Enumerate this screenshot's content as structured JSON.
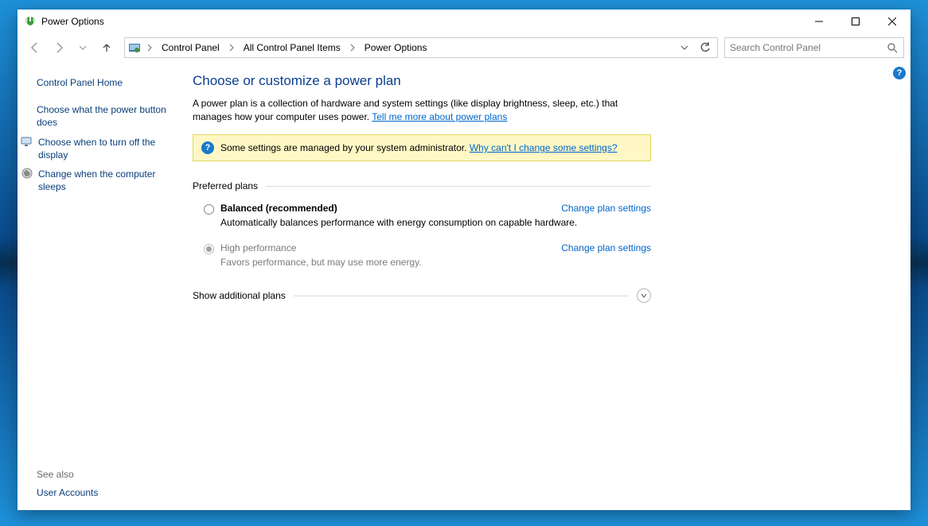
{
  "window": {
    "title": "Power Options"
  },
  "breadcrumb": {
    "items": [
      "Control Panel",
      "All Control Panel Items",
      "Power Options"
    ]
  },
  "search": {
    "placeholder": "Search Control Panel"
  },
  "sidebar": {
    "home": "Control Panel Home",
    "items": [
      "Choose what the power button does",
      "Choose when to turn off the display",
      "Change when the computer sleeps"
    ],
    "see_also_label": "See also",
    "see_also_items": [
      "User Accounts"
    ]
  },
  "main": {
    "heading": "Choose or customize a power plan",
    "description": "A power plan is a collection of hardware and system settings (like display brightness, sleep, etc.) that manages how your computer uses power. ",
    "description_link": "Tell me more about power plans",
    "notice_text": "Some settings are managed by your system administrator. ",
    "notice_link": "Why can't I change some settings?",
    "preferred_label": "Preferred plans",
    "plans": [
      {
        "name": "Balanced (recommended)",
        "desc": "Automatically balances performance with energy consumption on capable hardware.",
        "link": "Change plan settings",
        "selected": false,
        "enabled": true
      },
      {
        "name": "High performance",
        "desc": "Favors performance, but may use more energy.",
        "link": "Change plan settings",
        "selected": true,
        "enabled": false
      }
    ],
    "show_more_label": "Show additional plans"
  }
}
